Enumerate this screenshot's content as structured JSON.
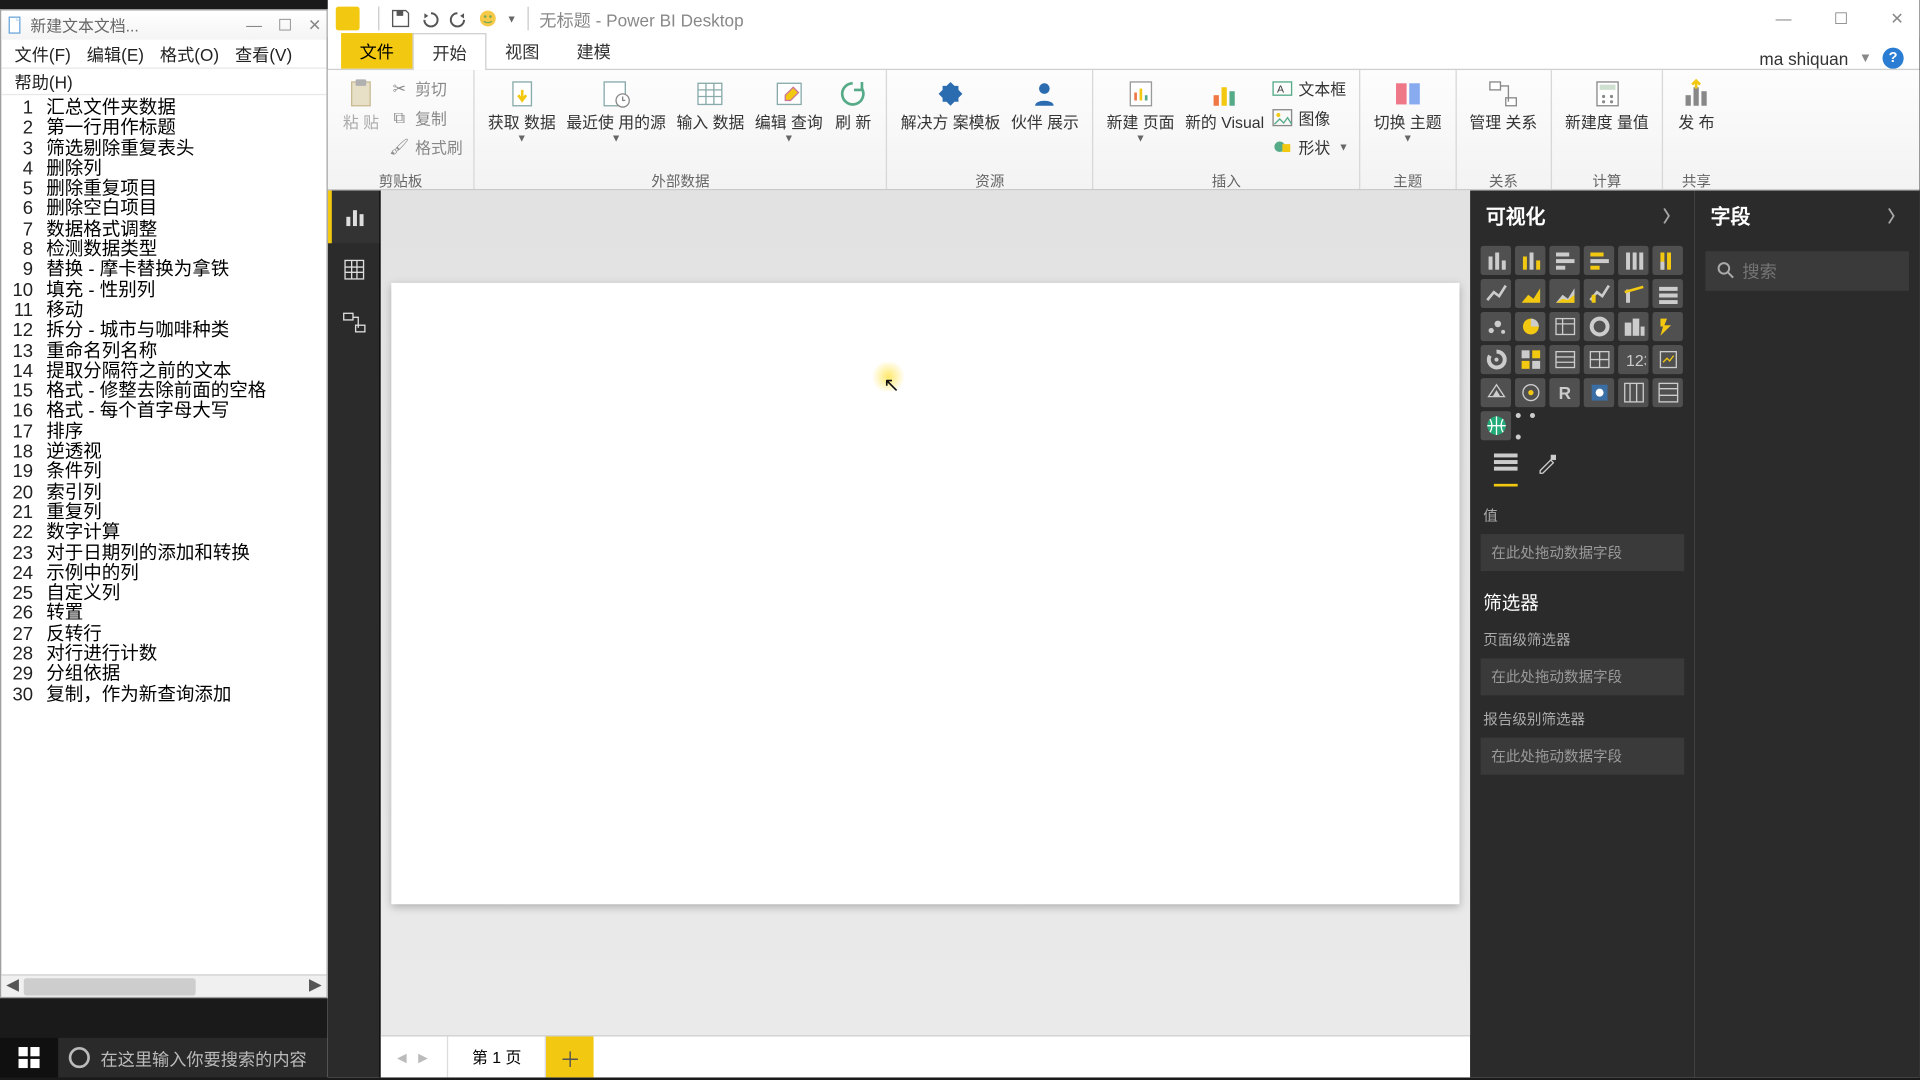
{
  "notepad": {
    "title": "新建文本文档...",
    "menu": [
      "文件(F)",
      "编辑(E)",
      "格式(O)",
      "查看(V)"
    ],
    "menu2": "帮助(H)",
    "lines": [
      "汇总文件夹数据",
      "第一行用作标题",
      "筛选剔除重复表头",
      "删除列",
      "删除重复项目",
      "删除空白项目",
      "数据格式调整",
      "检测数据类型",
      "替换 - 摩卡替换为拿铁",
      "填充 - 性别列",
      "移动",
      "拆分 - 城市与咖啡种类",
      "重命名列名称",
      "提取分隔符之前的文本",
      "格式 - 修整去除前面的空格",
      "格式 - 每个首字母大写",
      "排序",
      "逆透视",
      "条件列",
      "索引列",
      "重复列",
      "数字计算",
      "对于日期列的添加和转换",
      "示例中的列",
      "自定义列",
      "转置",
      "反转行",
      "对行进行计数",
      "分组依据",
      "复制，作为新查询添加"
    ]
  },
  "pbi": {
    "title": "无标题 - Power BI Desktop",
    "user": "ma shiquan",
    "tabs": {
      "file": "文件",
      "home": "开始",
      "view": "视图",
      "model": "建模"
    },
    "ribbon": {
      "clipboard": {
        "label": "剪贴板",
        "paste": "粘\n贴",
        "cut": "剪切",
        "copy": "复制",
        "painter": "格式刷"
      },
      "external": {
        "label": "外部数据",
        "get": "获取\n数据",
        "recent": "最近使\n用的源",
        "enter": "输入\n数据",
        "edit": "编辑\n查询",
        "refresh": "刷\n新"
      },
      "resources": {
        "label": "资源",
        "solution": "解决方\n案模板",
        "partner": "伙伴\n展示"
      },
      "insert": {
        "label": "插入",
        "newpage": "新建\n页面",
        "newvisual": "新的\nVisual",
        "textbox": "文本框",
        "image": "图像",
        "shape": "形状"
      },
      "theme": {
        "label": "主题",
        "switch": "切换\n主题"
      },
      "relation": {
        "label": "关系",
        "manage": "管理\n关系"
      },
      "calc": {
        "label": "计算",
        "measure": "新建度\n量值"
      },
      "share": {
        "label": "共享",
        "publish": "发\n布"
      }
    },
    "page_tab": "第 1 页",
    "viz": {
      "title": "可视化",
      "values": "值",
      "drop": "在此处拖动数据字段",
      "filters_title": "筛选器",
      "page_filter": "页面级筛选器",
      "report_filter": "报告级别筛选器"
    },
    "fields": {
      "title": "字段",
      "search_ph": "搜索"
    }
  },
  "taskbar": {
    "search_ph": "在这里输入你要搜索的内容"
  }
}
